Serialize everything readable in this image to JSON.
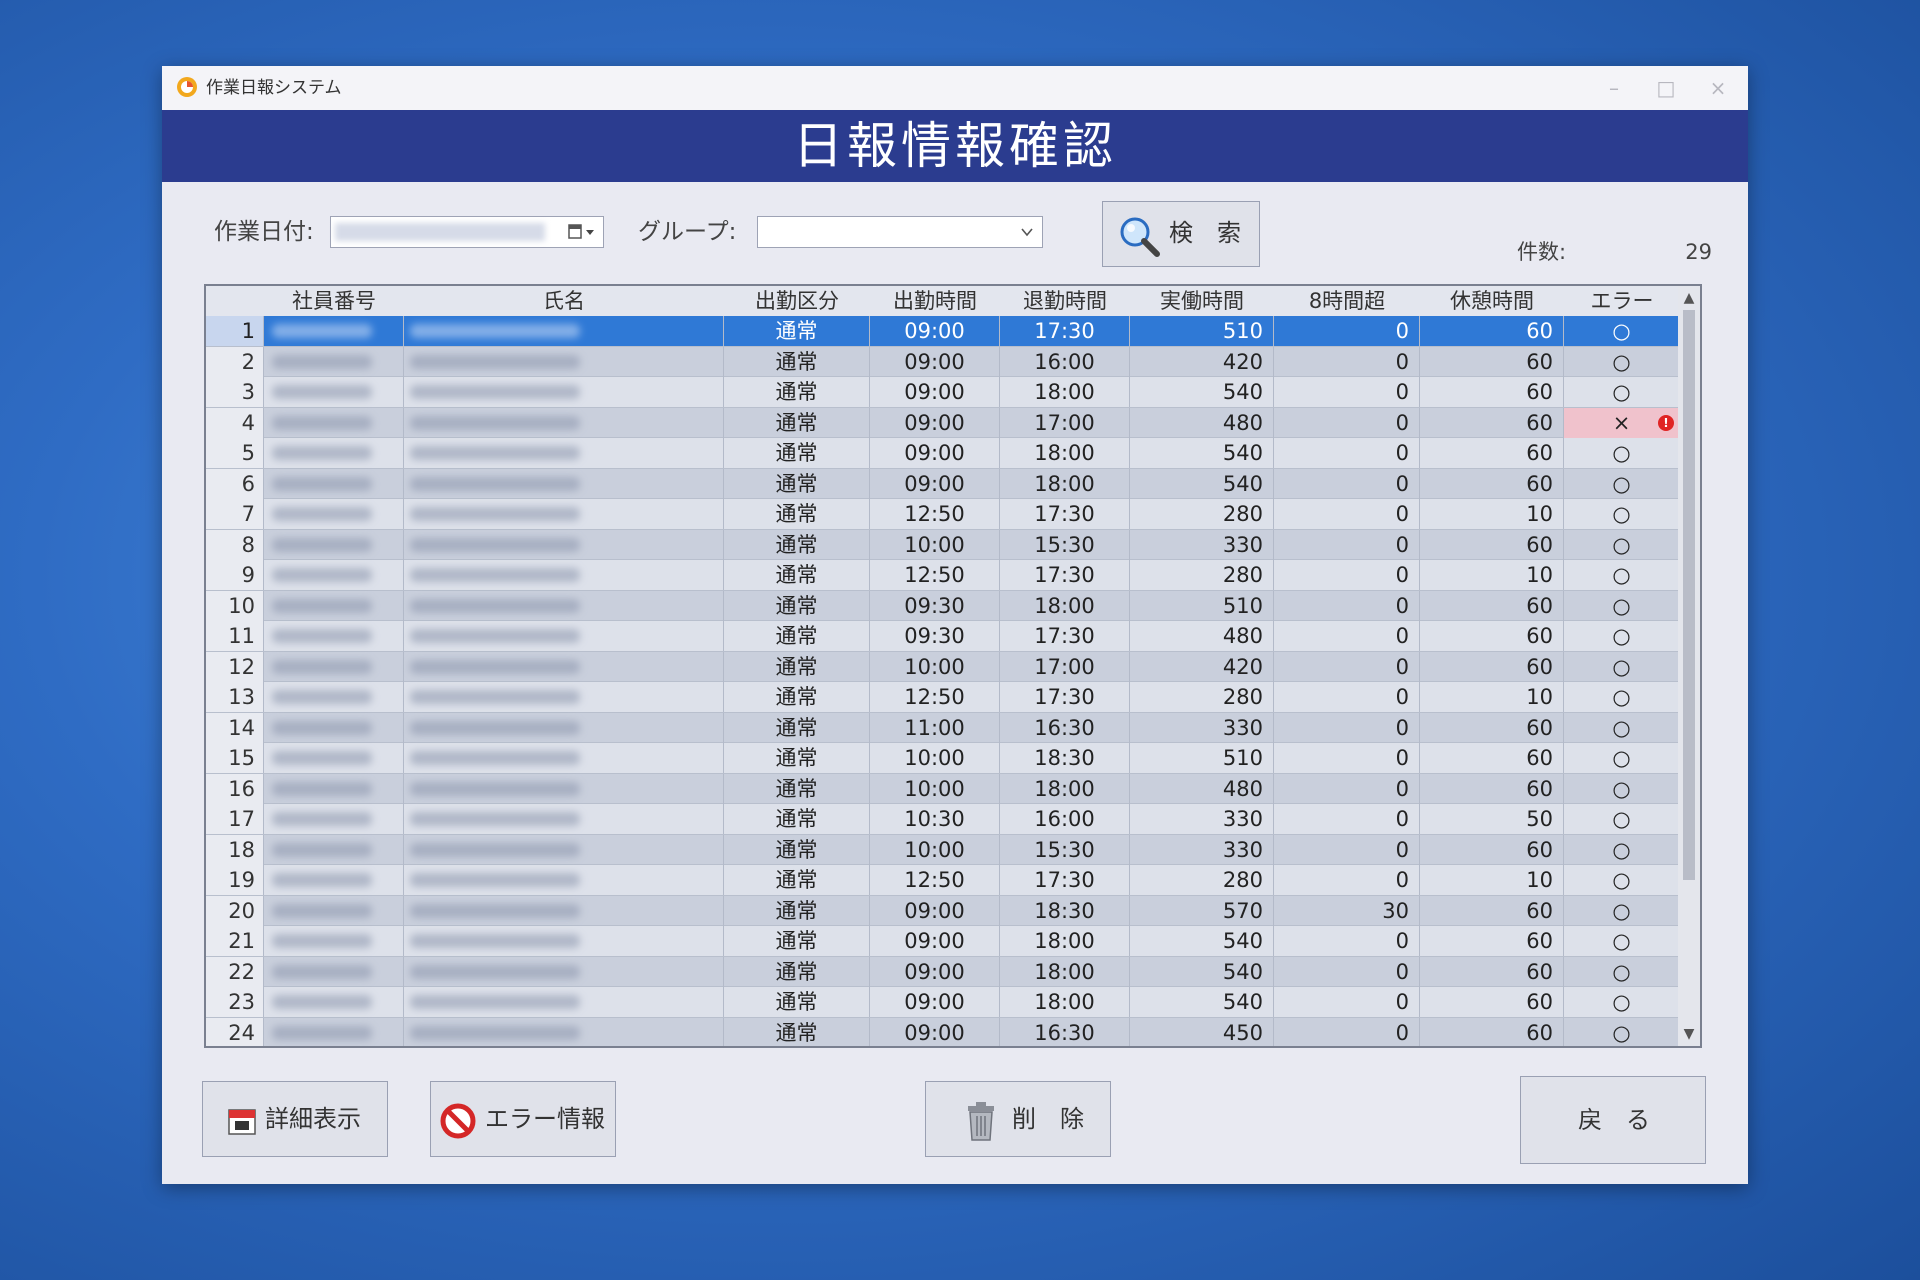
{
  "window": {
    "title": "作業日報システム",
    "minimize_glyph": "–",
    "maximize_glyph": "□",
    "close_glyph": "×"
  },
  "header": {
    "title": "日報情報確認"
  },
  "filters": {
    "date_label": "作業日付:",
    "group_label": "グループ:",
    "search_label": "検　索"
  },
  "count": {
    "label": "件数:",
    "value": "29"
  },
  "table": {
    "columns": [
      "社員番号",
      "氏名",
      "出勤区分",
      "出勤時間",
      "退勤時間",
      "実働時間",
      "8時間超",
      "休憩時間",
      "エラー"
    ],
    "rows": [
      {
        "no": "1",
        "kubun": "通常",
        "in": "09:00",
        "out": "17:30",
        "work": "510",
        "over": "0",
        "rest": "60",
        "error": "○"
      },
      {
        "no": "2",
        "kubun": "通常",
        "in": "09:00",
        "out": "16:00",
        "work": "420",
        "over": "0",
        "rest": "60",
        "error": "○"
      },
      {
        "no": "3",
        "kubun": "通常",
        "in": "09:00",
        "out": "18:00",
        "work": "540",
        "over": "0",
        "rest": "60",
        "error": "○"
      },
      {
        "no": "4",
        "kubun": "通常",
        "in": "09:00",
        "out": "17:00",
        "work": "480",
        "over": "0",
        "rest": "60",
        "error": "×"
      },
      {
        "no": "5",
        "kubun": "通常",
        "in": "09:00",
        "out": "18:00",
        "work": "540",
        "over": "0",
        "rest": "60",
        "error": "○"
      },
      {
        "no": "6",
        "kubun": "通常",
        "in": "09:00",
        "out": "18:00",
        "work": "540",
        "over": "0",
        "rest": "60",
        "error": "○"
      },
      {
        "no": "7",
        "kubun": "通常",
        "in": "12:50",
        "out": "17:30",
        "work": "280",
        "over": "0",
        "rest": "10",
        "error": "○"
      },
      {
        "no": "8",
        "kubun": "通常",
        "in": "10:00",
        "out": "15:30",
        "work": "330",
        "over": "0",
        "rest": "60",
        "error": "○"
      },
      {
        "no": "9",
        "kubun": "通常",
        "in": "12:50",
        "out": "17:30",
        "work": "280",
        "over": "0",
        "rest": "10",
        "error": "○"
      },
      {
        "no": "10",
        "kubun": "通常",
        "in": "09:30",
        "out": "18:00",
        "work": "510",
        "over": "0",
        "rest": "60",
        "error": "○"
      },
      {
        "no": "11",
        "kubun": "通常",
        "in": "09:30",
        "out": "17:30",
        "work": "480",
        "over": "0",
        "rest": "60",
        "error": "○"
      },
      {
        "no": "12",
        "kubun": "通常",
        "in": "10:00",
        "out": "17:00",
        "work": "420",
        "over": "0",
        "rest": "60",
        "error": "○"
      },
      {
        "no": "13",
        "kubun": "通常",
        "in": "12:50",
        "out": "17:30",
        "work": "280",
        "over": "0",
        "rest": "10",
        "error": "○"
      },
      {
        "no": "14",
        "kubun": "通常",
        "in": "11:00",
        "out": "16:30",
        "work": "330",
        "over": "0",
        "rest": "60",
        "error": "○"
      },
      {
        "no": "15",
        "kubun": "通常",
        "in": "10:00",
        "out": "18:30",
        "work": "510",
        "over": "0",
        "rest": "60",
        "error": "○"
      },
      {
        "no": "16",
        "kubun": "通常",
        "in": "10:00",
        "out": "18:00",
        "work": "480",
        "over": "0",
        "rest": "60",
        "error": "○"
      },
      {
        "no": "17",
        "kubun": "通常",
        "in": "10:30",
        "out": "16:00",
        "work": "330",
        "over": "0",
        "rest": "50",
        "error": "○"
      },
      {
        "no": "18",
        "kubun": "通常",
        "in": "10:00",
        "out": "15:30",
        "work": "330",
        "over": "0",
        "rest": "60",
        "error": "○"
      },
      {
        "no": "19",
        "kubun": "通常",
        "in": "12:50",
        "out": "17:30",
        "work": "280",
        "over": "0",
        "rest": "10",
        "error": "○"
      },
      {
        "no": "20",
        "kubun": "通常",
        "in": "09:00",
        "out": "18:30",
        "work": "570",
        "over": "30",
        "rest": "60",
        "error": "○"
      },
      {
        "no": "21",
        "kubun": "通常",
        "in": "09:00",
        "out": "18:00",
        "work": "540",
        "over": "0",
        "rest": "60",
        "error": "○"
      },
      {
        "no": "22",
        "kubun": "通常",
        "in": "09:00",
        "out": "18:00",
        "work": "540",
        "over": "0",
        "rest": "60",
        "error": "○"
      },
      {
        "no": "23",
        "kubun": "通常",
        "in": "09:00",
        "out": "18:00",
        "work": "540",
        "over": "0",
        "rest": "60",
        "error": "○"
      },
      {
        "no": "24",
        "kubun": "通常",
        "in": "09:00",
        "out": "16:30",
        "work": "450",
        "over": "0",
        "rest": "60",
        "error": "○"
      }
    ]
  },
  "buttons": {
    "detail": "詳細表示",
    "error_info": "エラー情報",
    "delete": "削　除",
    "back": "戻　る"
  },
  "colors": {
    "header_band": "#2b3c8f",
    "selected_row": "#2f79d6",
    "error_cell": "#f0c2cc",
    "alert_icon": "#e02424"
  },
  "icons": {
    "app": "app-logo-icon",
    "search": "magnifier-icon",
    "detail": "calendar-icon",
    "error_info": "prohibited-icon",
    "delete": "trash-icon",
    "error_alert": "exclamation-icon"
  }
}
